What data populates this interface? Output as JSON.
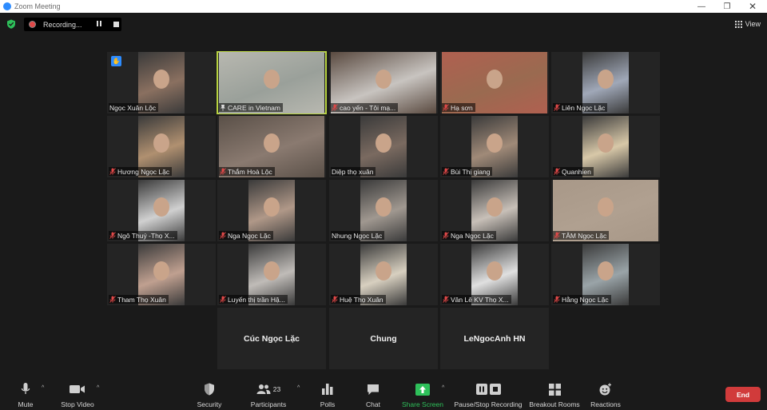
{
  "window": {
    "title": "Zoom Meeting"
  },
  "topbar": {
    "recording_label": "Recording...",
    "view_label": "View"
  },
  "participants": [
    {
      "name": "Ngọc Xuân Lộc",
      "muted": false,
      "hand": true,
      "video": "#8a7060",
      "bg": "#3a3a3a"
    },
    {
      "name": "CARE in Vietnam",
      "muted": false,
      "pinned": true,
      "video": "#9aa09a",
      "bg": "#b8b8b0",
      "active": true
    },
    {
      "name": "cao yến - Tôi mạ...",
      "muted": true,
      "video": "#c8c4c0",
      "bg": "#5a4a40"
    },
    {
      "name": "Hạ sơn",
      "muted": true,
      "video": "#9a6a50",
      "bg": "#b06050"
    },
    {
      "name": "Liên Ngọc Lặc",
      "muted": true,
      "video": "#a0a8b8",
      "bg": "#3a3a3a"
    },
    {
      "name": "Hương Ngọc Lặc",
      "muted": true,
      "video": "#b09070",
      "bg": "#3a3a3a"
    },
    {
      "name": "Thắm Hoà Lộc",
      "muted": true,
      "video": "#8a7a70",
      "bg": "#5a5048"
    },
    {
      "name": "Diệp thọ xuân",
      "muted": false,
      "video": "#7a6a60",
      "bg": "#3a3a3a"
    },
    {
      "name": "Bùi Thị giang",
      "muted": true,
      "video": "#a08a78",
      "bg": "#3a3a3a"
    },
    {
      "name": "Quanhien",
      "muted": true,
      "video": "#d8c8a8",
      "bg": "#3a3a3a"
    },
    {
      "name": "Ngô Thuý -Thọ X...",
      "muted": true,
      "video": "#d0d0d0",
      "bg": "#3a3a3a"
    },
    {
      "name": "Nga Ngọc Lặc",
      "muted": true,
      "video": "#b09888",
      "bg": "#3a3a3a"
    },
    {
      "name": "Nhung Ngọc Lặc",
      "muted": false,
      "video": "#a09890",
      "bg": "#3a3a3a"
    },
    {
      "name": "Nga Ngọc Lặc",
      "muted": true,
      "video": "#c8c0b8",
      "bg": "#3a3a3a"
    },
    {
      "name": "TÂM Ngọc Lặc",
      "muted": true,
      "video": "#b0a090",
      "bg": "#a89888"
    },
    {
      "name": "Tham Thọ Xuân",
      "muted": true,
      "video": "#c0a090",
      "bg": "#3a3a3a"
    },
    {
      "name": "Luyến thị trần Hậ...",
      "muted": true,
      "video": "#c0bcb8",
      "bg": "#3a3a3a"
    },
    {
      "name": "Huệ Thọ Xuân",
      "muted": true,
      "video": "#d8d0c0",
      "bg": "#3a3a3a"
    },
    {
      "name": "Vân Lê KV Thọ X...",
      "muted": true,
      "video": "#e0e0e0",
      "bg": "#3a3a3a"
    },
    {
      "name": "Hằng Ngọc Lặc",
      "muted": true,
      "video": "#9aa4a8",
      "bg": "#3a3a3a"
    }
  ],
  "name_tiles": [
    {
      "name": "Cúc Ngọc Lặc"
    },
    {
      "name": "Chung"
    },
    {
      "name": "LeNgocAnh HN"
    }
  ],
  "toolbar": {
    "mute": "Mute",
    "stop_video": "Stop Video",
    "security": "Security",
    "participants": "Participants",
    "participant_count": "23",
    "polls": "Polls",
    "chat": "Chat",
    "share_screen": "Share Screen",
    "pause_stop_recording": "Pause/Stop Recording",
    "breakout_rooms": "Breakout Rooms",
    "reactions": "Reactions",
    "end": "End"
  },
  "colors": {
    "accent_green": "#2ec05a",
    "active_speaker": "#b8d341",
    "end_red": "#d13b3b",
    "hand_blue": "#2d8cff"
  }
}
